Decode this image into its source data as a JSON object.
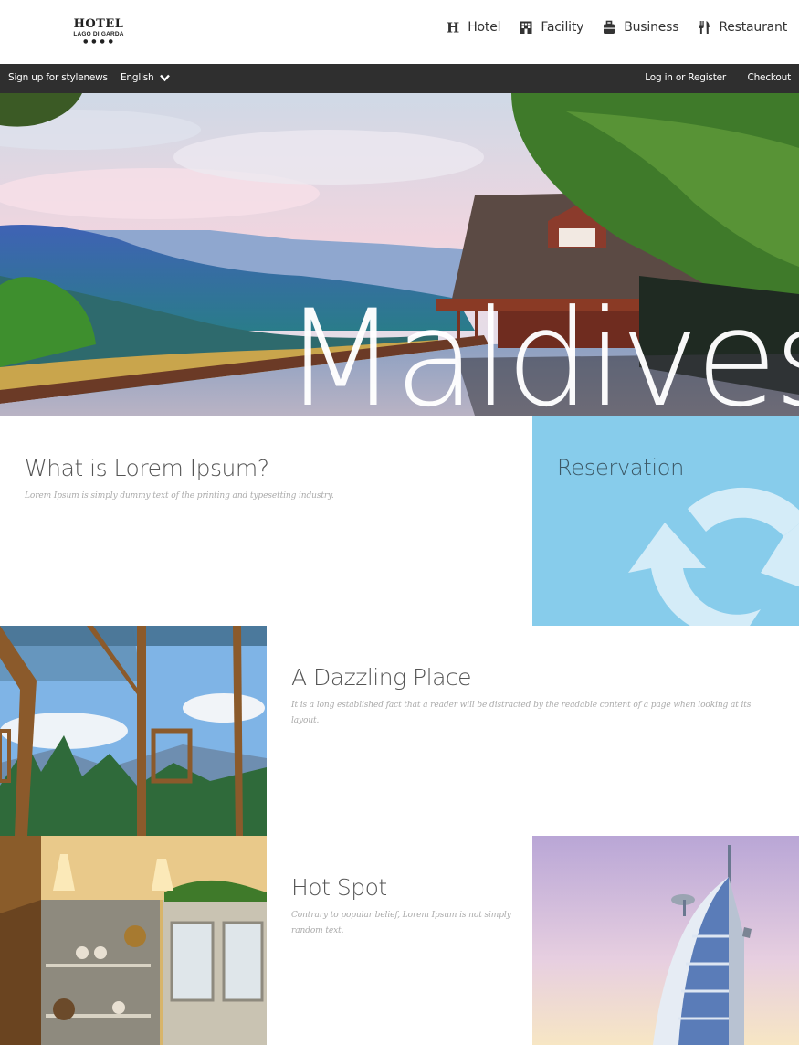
{
  "header": {
    "logo": {
      "title": "HOTEL",
      "subtitle": "LAGO DI GARDA",
      "dots": "● ● ● ●"
    },
    "nav": [
      {
        "label": "Hotel",
        "icon": "h-letter-icon"
      },
      {
        "label": "Facility",
        "icon": "building-icon"
      },
      {
        "label": "Business",
        "icon": "briefcase-icon"
      },
      {
        "label": "Restaurant",
        "icon": "cutlery-icon"
      }
    ]
  },
  "topbar": {
    "signup": "Sign up for stylenews",
    "language": "English",
    "login": "Log in or Register",
    "checkout": "Checkout"
  },
  "hero": {
    "title": "Maldives"
  },
  "sections": {
    "lorem": {
      "heading": "What is Lorem Ipsum?",
      "text": "Lorem Ipsum is simply dummy text of the printing and typesetting industry."
    },
    "reservation": {
      "label": "Reservation",
      "icon": "refresh-icon",
      "bg": "#87cceb"
    },
    "dazzling": {
      "heading": "A Dazzling Place",
      "text": "It is a long established fact that a reader will be distracted by the readable content of a page when looking at its layout."
    },
    "hotspot": {
      "heading": "Hot Spot",
      "text": "Contrary to popular belief, Lorem Ipsum is not simply random text."
    }
  },
  "colors": {
    "topbar": "#2f2f2f",
    "accent": "#87cceb",
    "text": "#555555"
  }
}
